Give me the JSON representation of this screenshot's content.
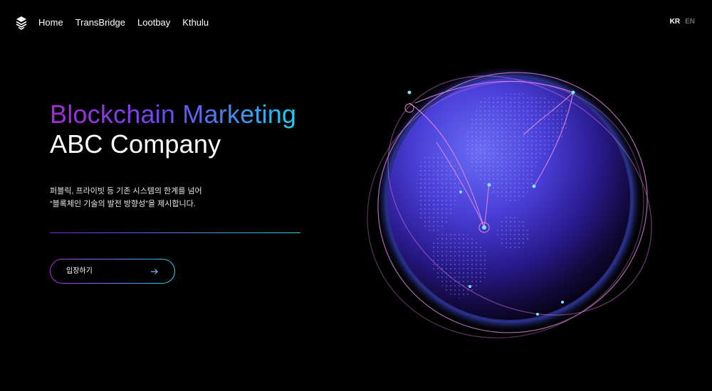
{
  "nav": {
    "items": [
      "Home",
      "TransBridge",
      "Lootbay",
      "Kthulu"
    ]
  },
  "lang": {
    "active": "KR",
    "inactive": "EN"
  },
  "hero": {
    "title_line1": "Blockchain Marketing",
    "title_line2": "ABC Company",
    "desc_line1": "퍼블릭, 프라이빗 등 기존 시스템의 한계를 넘어",
    "desc_line2": "“블록체인 기술의 발전 방향성”을 제시합니다.",
    "button_label": "입장하기"
  },
  "icons": {
    "logo": "logo-icon",
    "arrow": "arrow-right-icon",
    "globe": "globe-illustration"
  },
  "colors": {
    "background": "#000000",
    "gradient_start": "#a62bd8",
    "gradient_mid": "#6b4cf0",
    "gradient_end": "#1ed0f0"
  }
}
